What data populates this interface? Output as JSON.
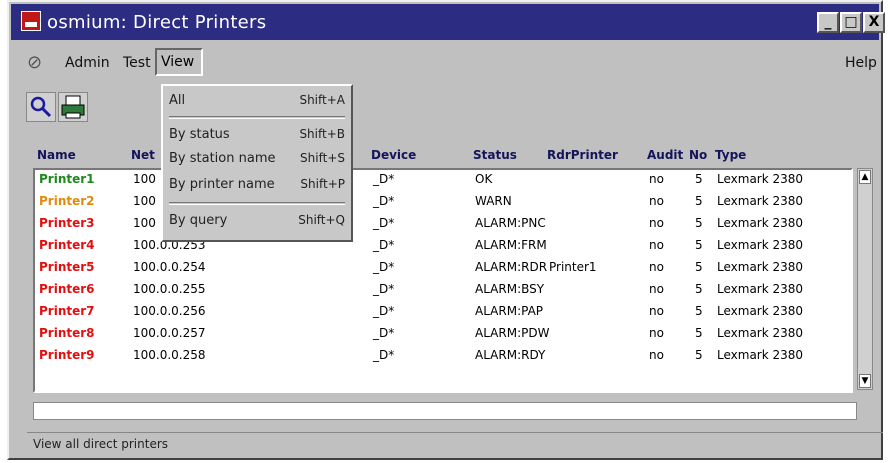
{
  "window": {
    "title": "osmium: Direct Printers",
    "buttons": [
      "_",
      "□",
      "X"
    ]
  },
  "menubar": {
    "items": [
      "Admin",
      "Test",
      "View"
    ],
    "help": "Help"
  },
  "toolbar": {
    "icons": [
      "search-icon",
      "printer-icon"
    ]
  },
  "table": {
    "columns": [
      "Name",
      "Net",
      "Device",
      "Status",
      "RdrPrinter",
      "Audit",
      "No",
      "Type"
    ],
    "rows": [
      {
        "name": "Printer1",
        "color": "#1e8a1e",
        "net": "100",
        "device": "_D*",
        "status": "OK",
        "rdr": "",
        "audit": "no",
        "no": "5",
        "type": "Lexmark 2380"
      },
      {
        "name": "Printer2",
        "color": "#e08a10",
        "net": "100",
        "device": "_D*",
        "status": "WARN",
        "rdr": "",
        "audit": "no",
        "no": "5",
        "type": "Lexmark 2380"
      },
      {
        "name": "Printer3",
        "color": "#e01010",
        "net": "100",
        "device": "_D*",
        "status": "ALARM:PNC",
        "rdr": "",
        "audit": "no",
        "no": "5",
        "type": "Lexmark 2380"
      },
      {
        "name": "Printer4",
        "color": "#e01010",
        "net": "100.0.0.253",
        "device": "_D*",
        "status": "ALARM:FRM",
        "rdr": "",
        "audit": "no",
        "no": "5",
        "type": "Lexmark 2380"
      },
      {
        "name": "Printer5",
        "color": "#e01010",
        "net": "100.0.0.254",
        "device": "_D*",
        "status": "ALARM:RDR",
        "rdr": "Printer1",
        "audit": "no",
        "no": "5",
        "type": "Lexmark 2380"
      },
      {
        "name": "Printer6",
        "color": "#e01010",
        "net": "100.0.0.255",
        "device": "_D*",
        "status": "ALARM:BSY",
        "rdr": "",
        "audit": "no",
        "no": "5",
        "type": "Lexmark 2380"
      },
      {
        "name": "Printer7",
        "color": "#e01010",
        "net": "100.0.0.256",
        "device": "_D*",
        "status": "ALARM:PAP",
        "rdr": "",
        "audit": "no",
        "no": "5",
        "type": "Lexmark 2380"
      },
      {
        "name": "Printer8",
        "color": "#e01010",
        "net": "100.0.0.257",
        "device": "_D*",
        "status": "ALARM:PDW",
        "rdr": "",
        "audit": "no",
        "no": "5",
        "type": "Lexmark 2380"
      },
      {
        "name": "Printer9",
        "color": "#e01010",
        "net": "100.0.0.258",
        "device": "_D*",
        "status": "ALARM:RDY",
        "rdr": "",
        "audit": "no",
        "no": "5",
        "type": "Lexmark 2380"
      }
    ]
  },
  "view_menu": {
    "items": [
      {
        "label": "All",
        "shortcut": "Shift+A"
      },
      {
        "label": "By status",
        "shortcut": "Shift+B"
      },
      {
        "label": "By station name",
        "shortcut": "Shift+S"
      },
      {
        "label": "By printer name",
        "shortcut": "Shift+P"
      },
      {
        "label": "By query",
        "shortcut": "Shift+Q"
      }
    ]
  },
  "status_bar": {
    "text": "View all direct printers"
  }
}
